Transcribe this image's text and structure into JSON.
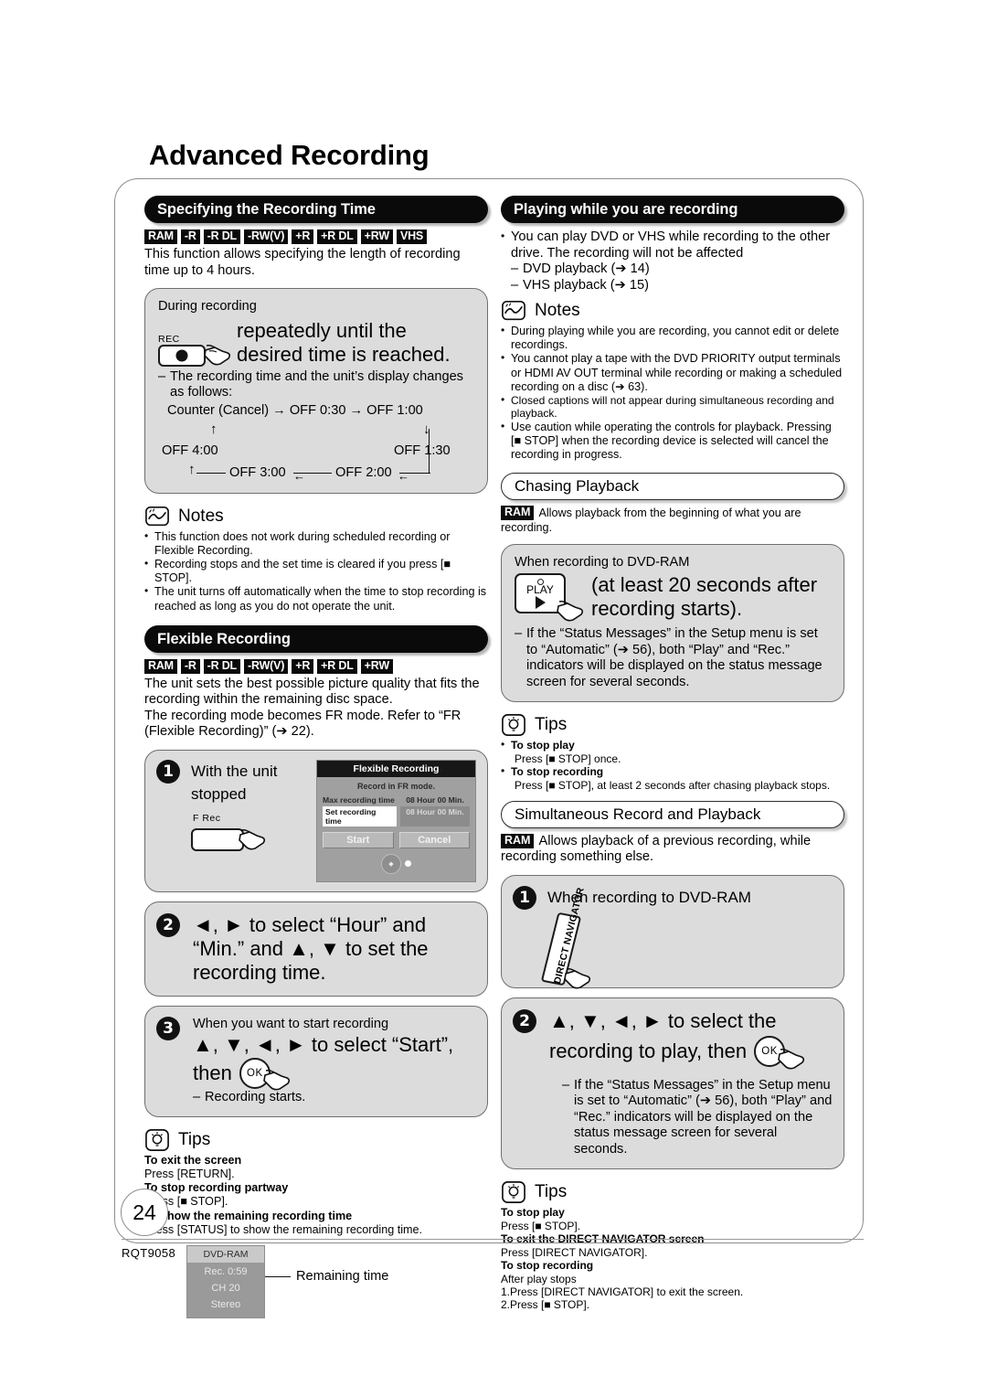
{
  "page": {
    "title": "Advanced Recording",
    "number": "24",
    "code": "RQT9058"
  },
  "left": {
    "section1": {
      "heading": "Specifying the Recording Time",
      "badges": [
        "RAM",
        "-R",
        "-R DL",
        "-RW(V)",
        "+R",
        "+R DL",
        "+RW",
        "VHS"
      ],
      "intro": "This function allows specifying the length of recording time up to 4 hours.",
      "box": {
        "caption": "During recording",
        "key_label": "REC",
        "instruction": "repeatedly until the desired time is reached.",
        "dash_line1": "The recording time and the unit’s display changes as follows:",
        "flow": {
          "row1": "Counter (Cancel)  →  OFF 0:30  →  OFF 1:00",
          "left_item": "OFF 4:00",
          "right_item": "OFF 1:30",
          "row3_a": "OFF 3:00",
          "row3_b": "OFF 2:00"
        }
      },
      "notes_title": "Notes",
      "notes": [
        "This function does not work during scheduled recording or Flexible Recording.",
        "Recording stops and the set time is cleared if you press [■ STOP].",
        "The unit turns off automatically when the time to stop recording is reached as long as you do not operate the unit."
      ]
    },
    "section2": {
      "heading": "Flexible Recording",
      "badges": [
        "RAM",
        "-R",
        "-R DL",
        "-RW(V)",
        "+R",
        "+R DL",
        "+RW"
      ],
      "intro1": "The unit sets the best possible picture quality that fits the recording within the remaining disc space.",
      "intro2": "The recording mode becomes FR mode. Refer to “FR (Flexible Recording)” (➔ 22).",
      "step1": {
        "num": "1",
        "caption": "With the unit stopped",
        "key_label": "F Rec",
        "dialog": {
          "title": "Flexible Recording",
          "subtitle": "Record in FR mode.",
          "max_label": "Max recording time",
          "max_value": "08 Hour 00 Min.",
          "set_label": "Set recording time",
          "set_value": "08 Hour 00 Min.",
          "start": "Start",
          "cancel": "Cancel"
        }
      },
      "step2": {
        "num": "2",
        "instruction": "◄, ► to select “Hour” and “Min.” and ▲, ▼ to set the recording time."
      },
      "step3": {
        "num": "3",
        "caption": "When you want to start recording",
        "instruction_a": "▲, ▼, ◄, ► to select “Start”,",
        "instruction_b": "then",
        "ok_label": "OK",
        "dash": "Recording starts."
      },
      "tips_title": "Tips",
      "tips": [
        {
          "head": "To exit the screen",
          "body": "Press [RETURN]."
        },
        {
          "head": "To stop recording partway",
          "body": "Press [■ STOP]."
        },
        {
          "head": "To show the remaining recording time",
          "body": "Press [STATUS] to show the remaining recording time."
        }
      ],
      "osd": {
        "header": "DVD-RAM",
        "line1": "Rec. 0:59",
        "line2": "CH 20",
        "line3": "Stereo",
        "callout": "Remaining time"
      }
    }
  },
  "right": {
    "section1": {
      "heading": "Playing while you are recording",
      "bullet": "You can play DVD or VHS while recording to the other drive. The recording will not be affected",
      "dashes": [
        "DVD playback (➔ 14)",
        "VHS playback (➔ 15)"
      ],
      "notes_title": "Notes",
      "notes": [
        "During playing while you are recording, you cannot edit or delete recordings.",
        "You cannot play a tape with the DVD PRIORITY output terminals or HDMI AV OUT terminal while recording or making a scheduled recording on a disc (➔ 63).",
        "Closed captions will not appear during simultaneous recording and playback.",
        "Use caution while operating the controls for playback.  Pressing [■ STOP] when the recording device is selected will cancel the recording in progress."
      ]
    },
    "section2": {
      "heading": "Chasing Playback",
      "badge": "RAM",
      "intro": "Allows playback from the beginning of what you are recording.",
      "box": {
        "caption": "When recording to DVD-RAM",
        "key_led": "",
        "key_label": "PLAY",
        "instruction": "(at least 20 seconds after recording starts).",
        "dash": "If the “Status Messages” in the Setup menu is set to “Automatic” (➔ 56), both “Play” and “Rec.” indicators will be displayed on the status message screen for several seconds."
      },
      "tips_title": "Tips",
      "tips": [
        {
          "head": "To stop play",
          "body": "Press [■ STOP] once."
        },
        {
          "head": "To stop recording",
          "body": "Press [■ STOP], at least 2 seconds after chasing playback stops."
        }
      ]
    },
    "section3": {
      "heading": "Simultaneous Record and Playback",
      "badge": "RAM",
      "intro": "Allows playback of a previous recording, while recording something else.",
      "step1": {
        "num": "1",
        "caption": "When recording to DVD-RAM",
        "key_label": "DIRECT NAVIGATOR"
      },
      "step2": {
        "num": "2",
        "instruction_a": "▲, ▼, ◄, ► to select the",
        "instruction_b": "recording to play, then",
        "ok_label": "OK",
        "dash": "If the “Status Messages” in the Setup menu is set to “Automatic” (➔ 56), both “Play” and “Rec.” indicators will be displayed on the status message screen for several seconds."
      },
      "tips_title": "Tips",
      "tips": [
        {
          "head": "To stop play",
          "body": "Press [■ STOP]."
        },
        {
          "head": "To exit the DIRECT NAVIGATOR screen",
          "body": "Press [DIRECT NAVIGATOR]."
        },
        {
          "head": "To stop recording",
          "body": "After play stops"
        }
      ],
      "numbered": [
        "1.Press [DIRECT NAVIGATOR] to exit the screen.",
        "2.Press [■ STOP]."
      ]
    }
  }
}
